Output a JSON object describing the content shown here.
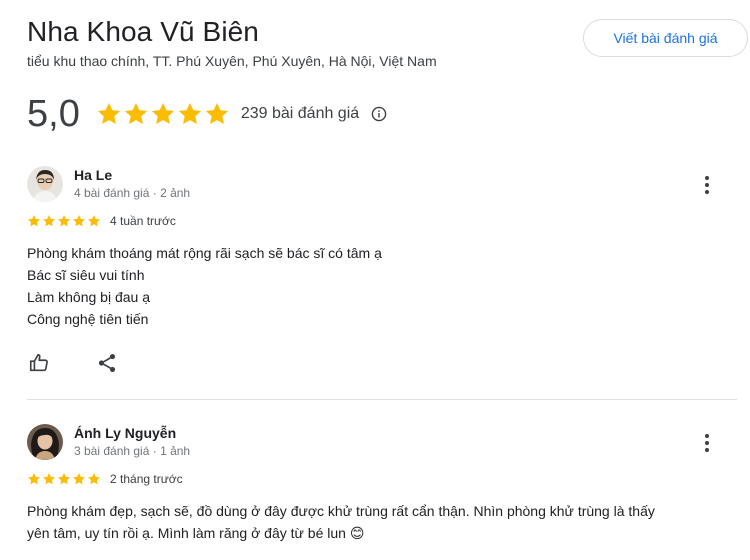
{
  "place": {
    "name": "Nha Khoa Vũ Biên",
    "address": "tiểu khu thao chính, TT. Phú Xuyên, Phú Xuyên, Hà Nội, Việt Nam",
    "write_review_label": "Viết bài đánh giá"
  },
  "summary": {
    "rating": "5,0",
    "review_count": "239 bài đánh giá",
    "star_color": "#fbbc04"
  },
  "reviews": [
    {
      "author": "Ha Le",
      "meta": "4 bài đánh giá · 2 ảnh",
      "time": "4 tuần trước",
      "lines": [
        "Phòng khám thoáng mát rộng rãi sạch sẽ bác sĩ có tâm ạ",
        "Bác sĩ siêu vui tính",
        "Làm không bị đau ạ",
        "Công nghệ tiên tiến"
      ]
    },
    {
      "author": "Ánh Ly Nguyễn",
      "meta": "3 bài đánh giá · 1 ảnh",
      "time": "2 tháng trước",
      "lines": [
        "Phòng khám đẹp, sạch sẽ, đồ dùng ở đây được khử trùng rất cẩn thận. Nhìn phòng khử trùng là thấy",
        "yên tâm, uy tín rồi ạ. Mình làm răng ở đây từ bé lun 😊"
      ]
    }
  ]
}
